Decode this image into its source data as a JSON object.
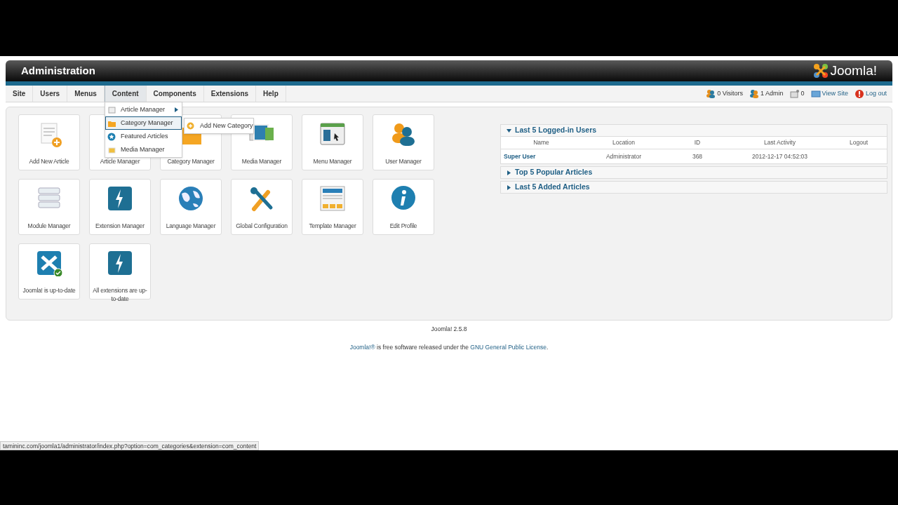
{
  "header": {
    "title": "Administration",
    "logo_text": "Joomla!"
  },
  "menu": [
    {
      "label": "Site",
      "selected": false
    },
    {
      "label": "Users",
      "selected": false
    },
    {
      "label": "Menus",
      "selected": false
    },
    {
      "label": "Content",
      "selected": true
    },
    {
      "label": "Components",
      "selected": false
    },
    {
      "label": "Extensions",
      "selected": false
    },
    {
      "label": "Help",
      "selected": false
    }
  ],
  "status": [
    {
      "kind": "visitors",
      "label": "0 Visitors"
    },
    {
      "kind": "admin",
      "label": "1 Admin"
    },
    {
      "kind": "messages",
      "label": "0"
    },
    {
      "kind": "viewsite",
      "label": "View Site"
    },
    {
      "kind": "logout",
      "label": "Log out"
    }
  ],
  "dropdown": [
    {
      "label": "Article Manager",
      "kind": "article",
      "selected": false,
      "has_submenu": true
    },
    {
      "label": "Category Manager",
      "kind": "category",
      "selected": true,
      "has_submenu": true,
      "submenu": [
        "Add New Category"
      ]
    },
    {
      "label": "Featured Articles",
      "kind": "featured",
      "selected": false,
      "has_submenu": false
    },
    {
      "label": "Media Manager",
      "kind": "media",
      "selected": false,
      "has_submenu": false
    }
  ],
  "tiles": [
    {
      "label": "Add New Article",
      "kind": "addarticle"
    },
    {
      "label": "Article Manager",
      "kind": "hidden"
    },
    {
      "label": "Category Manager",
      "kind": "folder"
    },
    {
      "label": "Media Manager",
      "kind": "media"
    },
    {
      "label": "Menu Manager",
      "kind": "menu"
    },
    {
      "label": "User Manager",
      "kind": "user"
    },
    {
      "label": "Module Manager",
      "kind": "module"
    },
    {
      "label": "Extension Manager",
      "kind": "bolt"
    },
    {
      "label": "Language Manager",
      "kind": "globe"
    },
    {
      "label": "Global Configuration",
      "kind": "tools"
    },
    {
      "label": "Template Manager",
      "kind": "template"
    },
    {
      "label": "Edit Profile",
      "kind": "info"
    },
    {
      "label": "Joomla! is up-to-date",
      "kind": "joomla"
    },
    {
      "label": "All extensions are up-to-date",
      "kind": "bolt"
    }
  ],
  "panels": [
    {
      "title": "Last 5 Logged-in Users",
      "expanded": true,
      "table": {
        "columns": [
          "Name",
          "Location",
          "ID",
          "Last Activity",
          "Logout"
        ],
        "rows": [
          [
            "Super User",
            "Administrator",
            "368",
            "2012-12-17 04:52:03",
            ""
          ]
        ]
      }
    },
    {
      "title": "Top 5 Popular Articles",
      "expanded": false
    },
    {
      "title": "Last 5 Added Articles",
      "expanded": false
    }
  ],
  "footer": {
    "version": "Joomla! 2.5.8",
    "license": [
      "Joomla!®",
      " is free software released under the ",
      "GNU General Public License",
      "."
    ]
  },
  "status_url": "tamininc.com/joomla1/administrator/index.php?option=com_categories&extension=com_content"
}
